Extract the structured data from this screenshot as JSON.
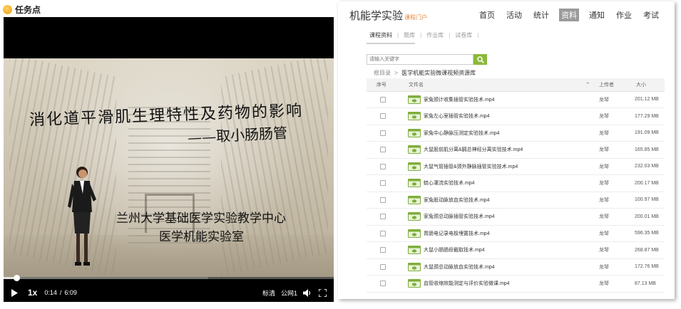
{
  "task": {
    "label": "任务点"
  },
  "video": {
    "title": "消化道平滑肌生理特性及药物的影响",
    "subtitle": "——取小肠肠管",
    "institution": "兰州大学基础医学实验教学中心",
    "lab": "医学机能实验室",
    "controls": {
      "rate": "1x",
      "current_time": "0:14",
      "separator": "/",
      "duration": "6:09",
      "quality": "标清",
      "line": "公网1"
    },
    "progress_fraction": 0.038,
    "buffered_fraction": 0.62
  },
  "portal": {
    "course_title": "机能学实验",
    "portal_tag": "课程门户",
    "nav": [
      {
        "label": "首页"
      },
      {
        "label": "活动"
      },
      {
        "label": "统计"
      },
      {
        "label": "资料",
        "active": true
      },
      {
        "label": "通知"
      },
      {
        "label": "作业"
      },
      {
        "label": "考试"
      }
    ],
    "tabs": [
      {
        "label": "课程资料",
        "active": true
      },
      {
        "label": "题库"
      },
      {
        "label": "作业库"
      },
      {
        "label": "试卷库"
      }
    ],
    "tab_separator": "|",
    "search": {
      "placeholder": "请输入关键字"
    },
    "breadcrumb": {
      "root": "根目录",
      "separator": ">",
      "current": "医学机能实验微课视频资源库"
    },
    "table": {
      "headers": {
        "no": "序号",
        "name": "文件名",
        "uploader": "上传者",
        "size": "大小"
      },
      "rows": [
        {
          "name": "家兔颈计收集插管实验技术.mp4",
          "uploader": "龙琴",
          "size": "201.12 MB"
        },
        {
          "name": "家兔左心室插管实验技术.mp4",
          "uploader": "龙琴",
          "size": "177.29 MB"
        },
        {
          "name": "家兔中心静脉压测定实验技术.mp4",
          "uploader": "龙琴",
          "size": "191.09 MB"
        },
        {
          "name": "大鼠股前肌分离&膈总神经分离实验技术.mp4",
          "uploader": "龙琴",
          "size": "165.85 MB"
        },
        {
          "name": "大鼠气管插管&颈外静脉插管实验技术.mp4",
          "uploader": "龙琴",
          "size": "232.03 MB"
        },
        {
          "name": "蛙心灌流实验技术.mp4",
          "uploader": "龙琴",
          "size": "200.17 MB"
        },
        {
          "name": "家兔股动脉放血实验技术.mp4",
          "uploader": "龙琴",
          "size": "100.97 MB"
        },
        {
          "name": "家兔颈总动脉插管实验技术.mp4",
          "uploader": "龙琴",
          "size": "200.01 MB"
        },
        {
          "name": "胃肠电记录电极埋置技术.mp4",
          "uploader": "龙琴",
          "size": "596.35 MB"
        },
        {
          "name": "大鼠小肠肠段截取技术.mp4",
          "uploader": "龙琴",
          "size": "268.87 MB"
        },
        {
          "name": "大鼠颈总动脉放血实验技术.mp4",
          "uploader": "龙琴",
          "size": "172.76 MB"
        },
        {
          "name": "血管收缩效能测定与评价实验微课.mp4",
          "uploader": "龙琴",
          "size": "87.13 MB"
        }
      ]
    }
  },
  "colors": {
    "accent_green": "#8bb93a",
    "task_orange": "#f29d0b",
    "nav_active_bg": "#9a9a9a",
    "portal_tag": "#e3863a"
  },
  "icons": [
    "task-dot-icon",
    "play-icon",
    "volume-icon",
    "fullscreen-icon",
    "search-icon",
    "video-file-icon",
    "sort-caret-icon"
  ]
}
